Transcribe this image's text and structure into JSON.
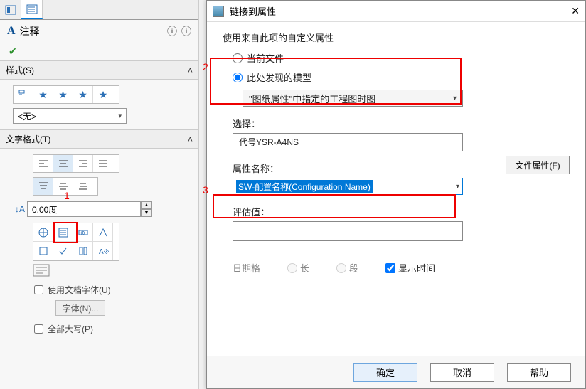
{
  "left": {
    "title": "注释",
    "sections": {
      "style": {
        "label": "样式(S)",
        "dropdown": "<无>"
      },
      "text_format": {
        "label": "文字格式(T)"
      }
    },
    "angle_value": "0.00度",
    "use_doc_font": "使用文档字体(U)",
    "font_btn": "字体(N)...",
    "all_caps": "全部大写(P)",
    "annot": {
      "n1": "1",
      "n2": "2",
      "n3": "3"
    }
  },
  "dialog": {
    "title": "链接到属性",
    "subtitle": "使用来自此项的自定义属性",
    "radio_current": "当前文件",
    "radio_model": "此处发现的模型",
    "model_dropdown": "\"图纸属性\"中指定的工程图时图",
    "select_label": "选择：",
    "select_value": "代号YSR-A4NS",
    "file_prop_btn": "文件属性(F)",
    "attr_name_label": "属性名称：",
    "attr_name_value": "SW-配置名称(Configuration Name)",
    "eval_label": "评估值：",
    "eval_value": "",
    "date_label": "日期格",
    "radio_long": "长",
    "radio_short": "段",
    "show_time": "显示时间",
    "ok": "确定",
    "cancel": "取消",
    "help": "帮助"
  }
}
